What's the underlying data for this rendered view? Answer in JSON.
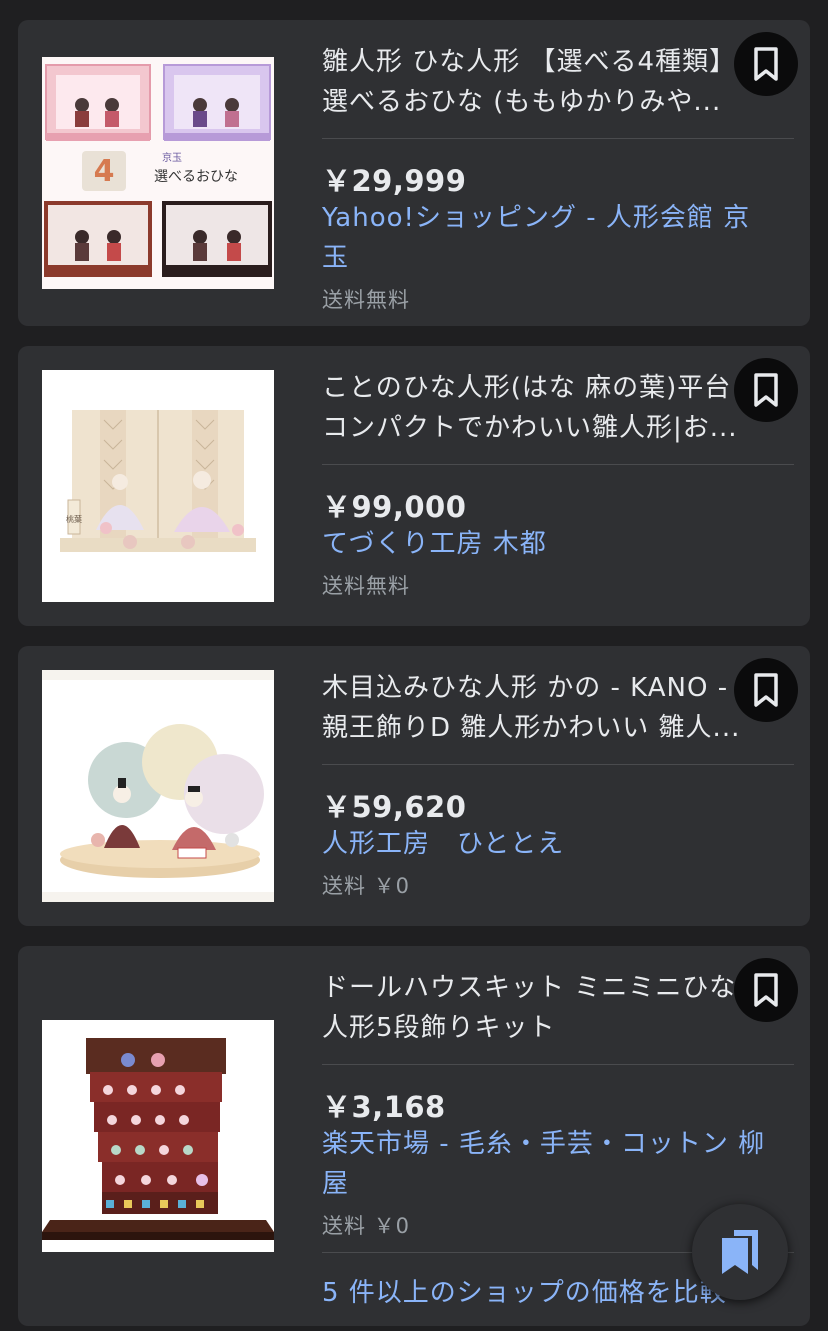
{
  "products": [
    {
      "title_line1": "雛人形 ひな人形 【選べる4種類】",
      "title_line2": "選べるおひな (ももゆかりみや...",
      "price": "￥29,999",
      "seller_line1": "Yahoo!ショッピング - 人形会館 京",
      "seller_line2": "玉",
      "shipping": "送料無料",
      "image_label": "選べるおひな",
      "image_badge": "4",
      "image_brand": "京玉"
    },
    {
      "title_line1": "ことのひな人形(はな 麻の葉)平台",
      "title_line2": "コンパクトでかわいい雛人形|お...",
      "price": "￥99,000",
      "seller_line1": "てづくり工房 木都",
      "shipping": "送料無料",
      "image_tag": "桃葉"
    },
    {
      "title_line1": "木目込みひな人形 かの - KANO -",
      "title_line2": "親王飾りD 雛人形かわいい 雛人...",
      "price": "￥59,620",
      "seller_line1": "人形工房　ひととえ",
      "shipping": "送料 ￥0"
    },
    {
      "title_line1": "ドールハウスキット ミニミニひな",
      "title_line2": "人形5段飾りキット",
      "price": "￥3,168",
      "seller_line1": "楽天市場 - 毛糸・手芸・コットン 柳",
      "seller_line2": "屋",
      "shipping": "送料 ￥0",
      "compare_text": "5 件以上のショップの価格を比較"
    }
  ],
  "icons": {
    "bookmark": "bookmark-icon",
    "saved_collections": "bookmarks-stack-icon"
  },
  "colors": {
    "background": "#1f1f21",
    "card": "#2f3033",
    "link": "#8ab4f8",
    "muted": "#9aa0a6"
  }
}
